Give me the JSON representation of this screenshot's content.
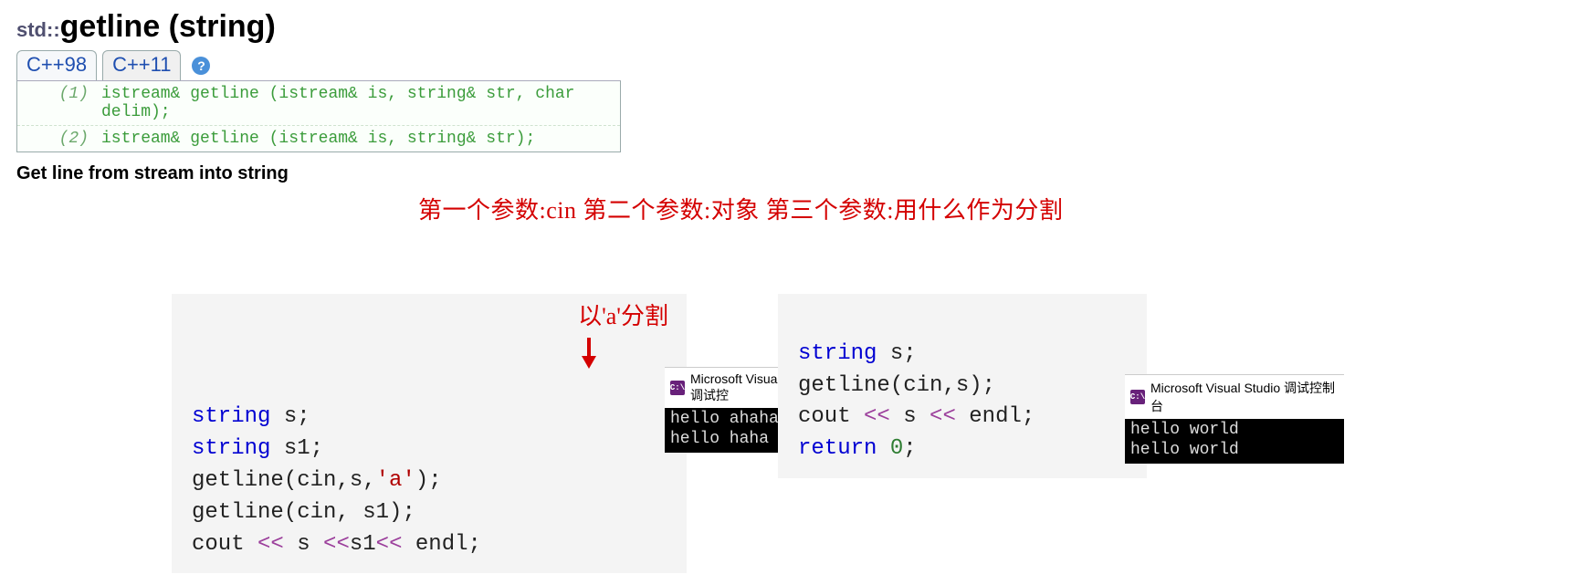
{
  "header": {
    "namespace": "std::",
    "name": "getline",
    "suffix": " (string)"
  },
  "tabs": {
    "t1": "C++98",
    "t2": "C++11"
  },
  "signatures": [
    {
      "idx": "(1)",
      "code": "istream& getline (istream& is, string& str, char delim);"
    },
    {
      "idx": "(2)",
      "code": "istream& getline (istream& is, string& str);"
    }
  ],
  "desc_title": "Get line from stream into string",
  "annotation_params": "第一个参数:cin 第二个参数:对象 第三个参数:用什么作为分割",
  "block_left": {
    "split_label": "以'a'分割",
    "code": {
      "kw1": "string",
      "v1": " s;",
      "kw2": "string",
      "v2": " s1;",
      "fn1": "getline(cin,s,",
      "lit": "'a'",
      "fn1b": ");",
      "fn2": "getline(cin, s1);",
      "cout_kw": "cout ",
      "op1": "<< ",
      "sv": "s ",
      "op2": "<<",
      "s1v": "s1",
      "op3": "<< ",
      "endl": "endl",
      "semi": ";"
    },
    "vs_title": "Microsoft Visual Studio 调试控",
    "console": "hello ahaha\nhello haha"
  },
  "block_right": {
    "code": {
      "kw1": "string",
      "v1": " s;",
      "fn1": "getline(cin,s);",
      "cout_kw": "cout ",
      "op1": "<< ",
      "sv": "s ",
      "op2": "<< ",
      "endl": "endl",
      "semi": ";",
      "ret": "return ",
      "zero": "0",
      "semi2": ";"
    },
    "vs_title": "Microsoft Visual Studio 调试控制台",
    "console": "hello world\nhello world"
  }
}
